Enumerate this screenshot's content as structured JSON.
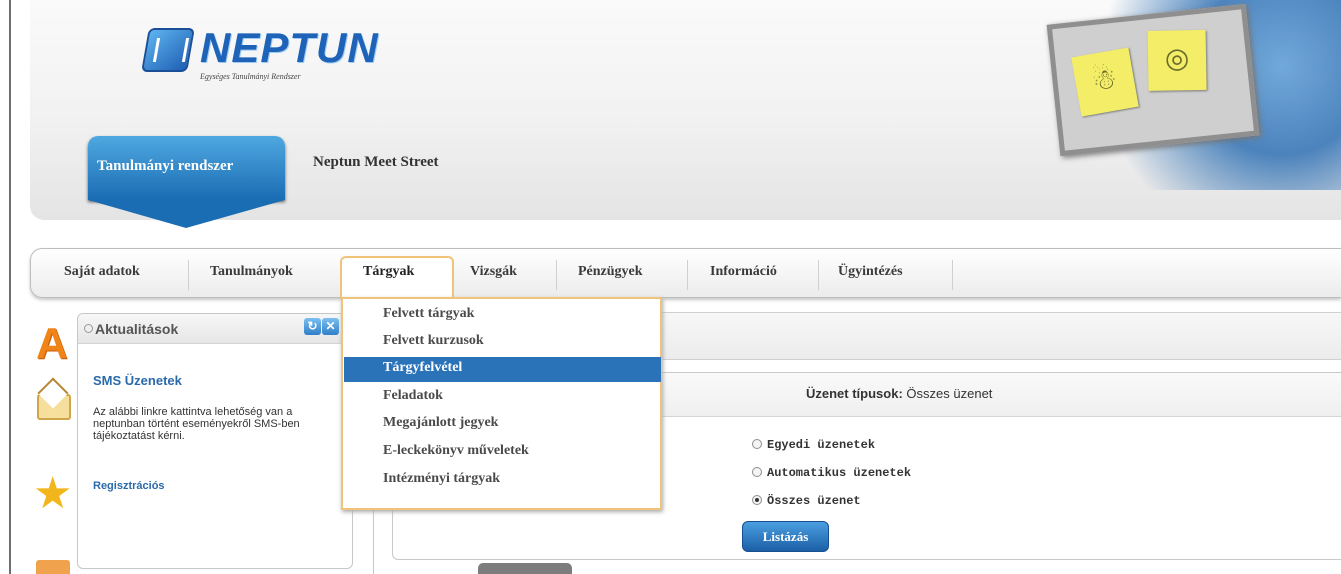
{
  "logo": {
    "name": "NEPTUN",
    "tagline": "Egységes Tanulmányi Rendszer"
  },
  "top_tabs": [
    {
      "label": "Tanulmányi rendszer",
      "active": true
    },
    {
      "label": "Neptun Meet Street",
      "active": false
    }
  ],
  "menu": {
    "items": [
      {
        "label": "Saját adatok"
      },
      {
        "label": "Tanulmányok"
      },
      {
        "label": "Tárgyak",
        "active": true
      },
      {
        "label": "Vizsgák"
      },
      {
        "label": "Pénzügyek"
      },
      {
        "label": "Információ"
      },
      {
        "label": "Ügyintézés"
      }
    ],
    "dropdown": [
      {
        "label": "Felvett tárgyak"
      },
      {
        "label": "Felvett kurzusok"
      },
      {
        "label": "Tárgyfelvétel",
        "selected": true
      },
      {
        "label": "Feladatok"
      },
      {
        "label": "Megajánlott jegyek"
      },
      {
        "label": "E-leckekönyv műveletek"
      },
      {
        "label": "Intézményi tárgyak"
      }
    ]
  },
  "side_icons": [
    "a-letter-icon",
    "envelope-icon",
    "star-icon",
    "calendar-icon"
  ],
  "news": {
    "title": "Aktualitások",
    "subtitle": "SMS Üzenetek",
    "body": "Az alábbi linkre kattintva lehetőség van a neptunban történt eseményekről SMS-ben tájékoztatást kérni.",
    "link": "Regisztrációs"
  },
  "messages": {
    "filter_label": "Üzenet típusok:",
    "filter_value": "Összes üzenet",
    "options": [
      {
        "label": "Egyedi üzenetek",
        "checked": false
      },
      {
        "label": "Automatikus üzenetek",
        "checked": false
      },
      {
        "label": "Összes üzenet",
        "checked": true
      }
    ],
    "list_button": "Listázás"
  },
  "colors": {
    "accent": "#1f6fb8",
    "menu_highlight": "#f1c27a",
    "selected_row": "#2a73b8"
  }
}
